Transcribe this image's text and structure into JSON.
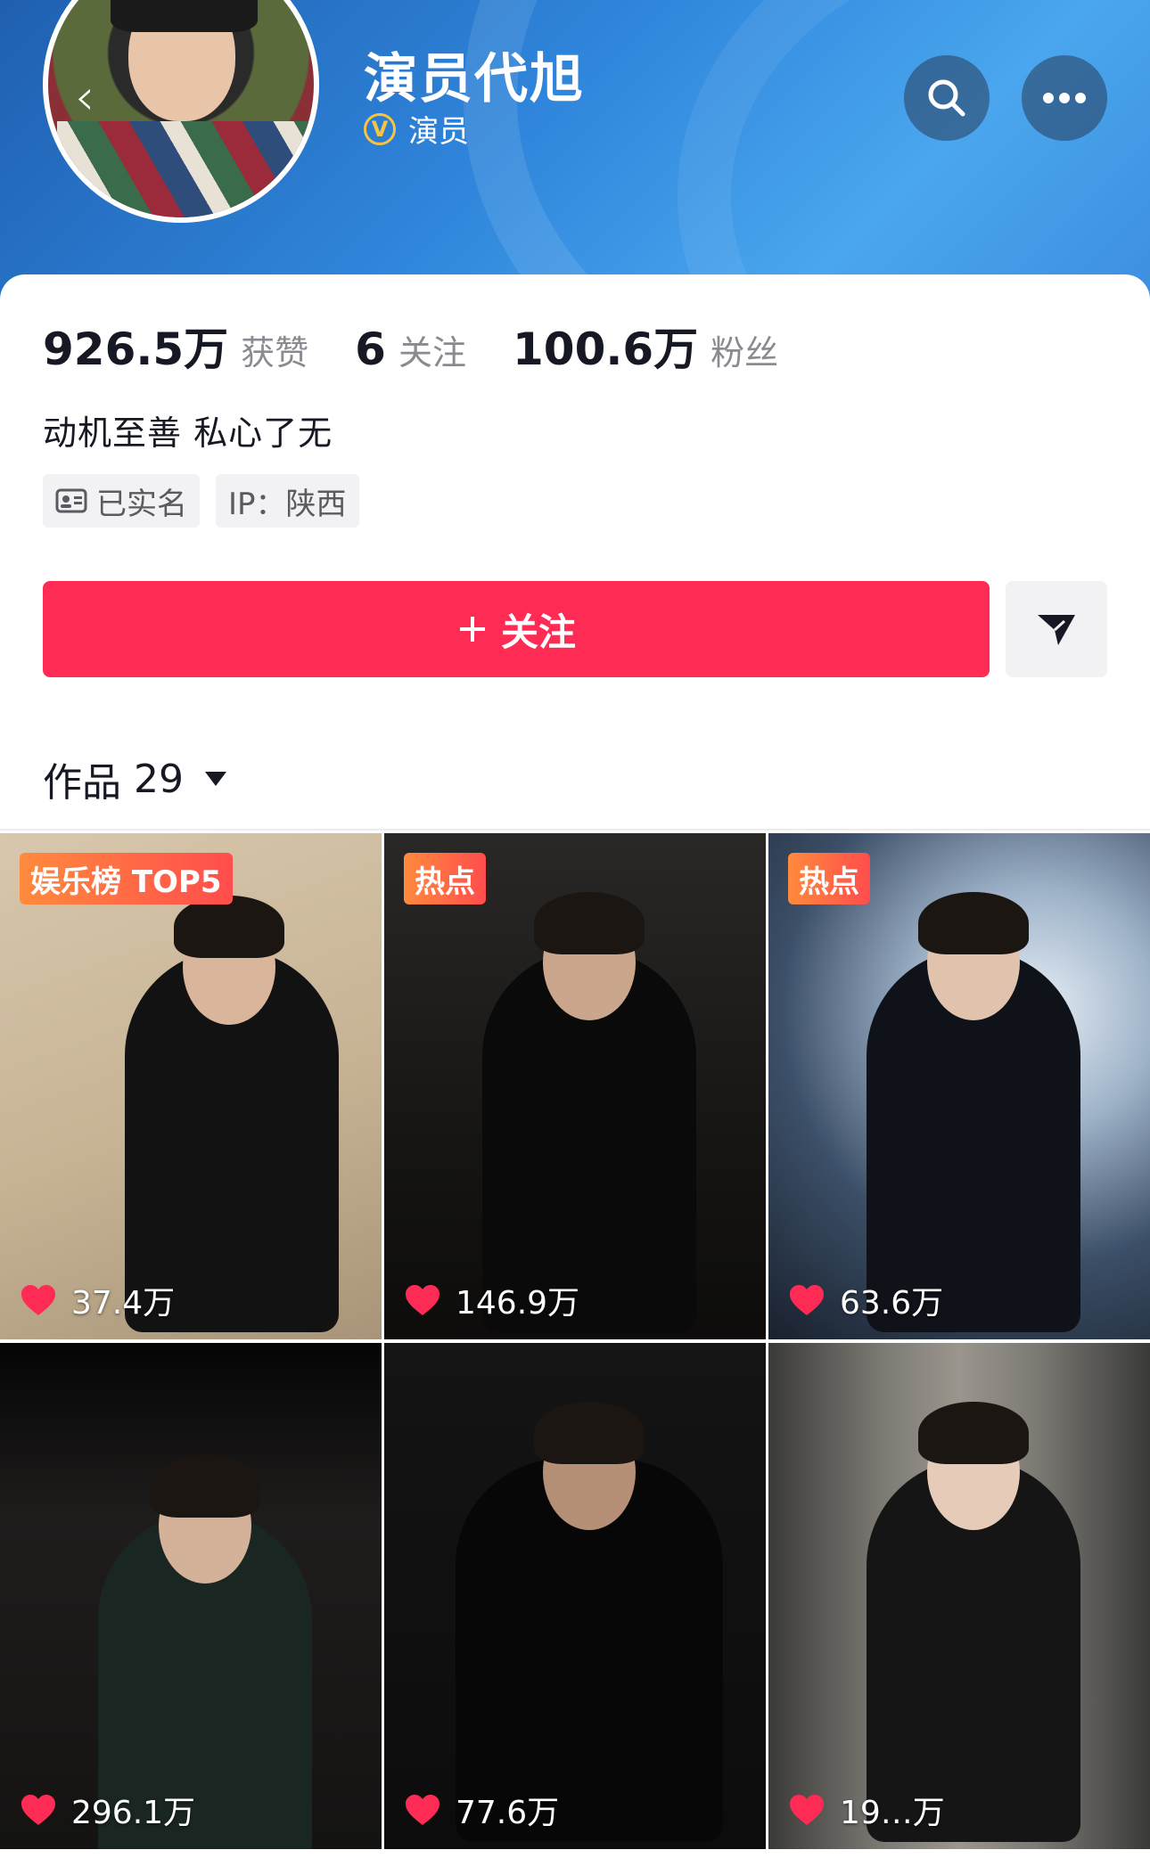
{
  "profile": {
    "name": "演员代旭",
    "verified_label": "演员",
    "bio": "动机至善 私心了无",
    "tags": [
      "已实名",
      "IP：陕西"
    ]
  },
  "stats": [
    {
      "value": "926.5万",
      "label": "获赞"
    },
    {
      "value": "6",
      "label": "关注"
    },
    {
      "value": "100.6万",
      "label": "粉丝"
    }
  ],
  "actions": {
    "follow_label": "关注",
    "back_icon": "chevron-left-icon",
    "search_icon": "search-icon",
    "more_icon": "more-icon",
    "message_icon": "send-icon"
  },
  "works": {
    "label": "作品",
    "count": "29",
    "items": [
      {
        "badge": "娱乐榜 TOP5",
        "likes": "37.4万"
      },
      {
        "badge": "热点",
        "likes": "146.9万"
      },
      {
        "badge": "热点",
        "likes": "63.6万"
      },
      {
        "badge": "",
        "likes": "296.1万"
      },
      {
        "badge": "",
        "likes": "77.6万"
      },
      {
        "badge": "",
        "likes": "19…万"
      }
    ]
  },
  "colors": {
    "accent": "#fe2c55",
    "header_blue": "#2f86dc",
    "badge_orange": "#ff6a3d",
    "verify_gold": "#f6c442"
  }
}
